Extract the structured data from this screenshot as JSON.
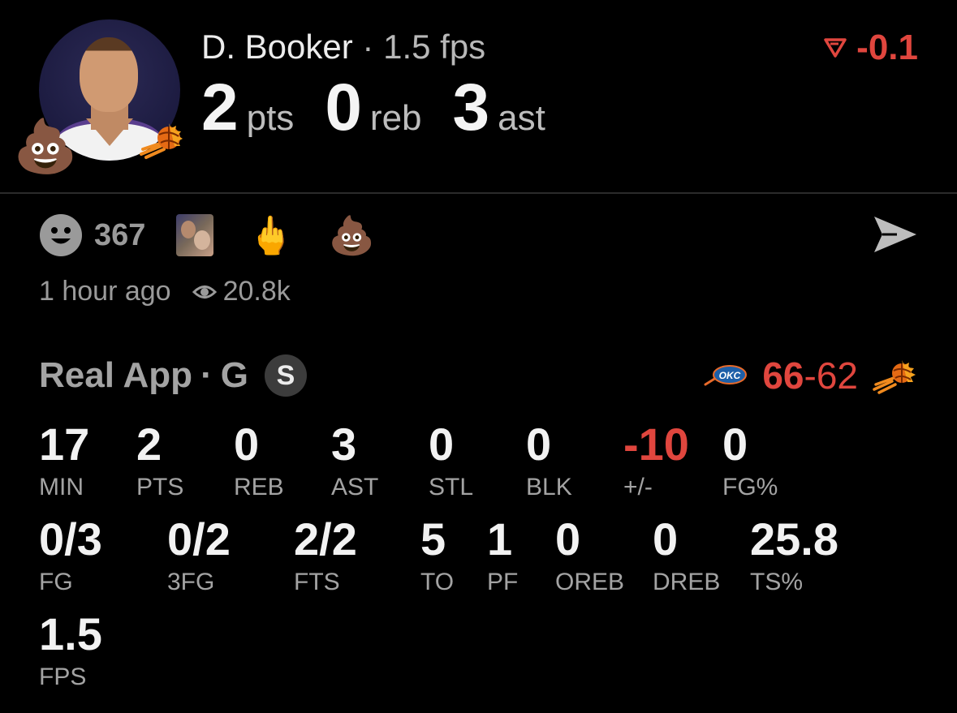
{
  "player": {
    "name": "D. Booker",
    "separator": "·",
    "fps": "1.5 fps",
    "delta": "-0.1",
    "delta_color": "#e0463e",
    "headline": [
      {
        "value": "2",
        "unit": "pts"
      },
      {
        "value": "0",
        "unit": "reb"
      },
      {
        "value": "3",
        "unit": "ast"
      }
    ]
  },
  "icons": {
    "badge_emoji": "💩",
    "team_badge": "suns-logo-icon",
    "delta_icon": "down-triangle-icon"
  },
  "reactions": {
    "count": "367",
    "items": [
      {
        "name": "photo-reaction"
      },
      {
        "name": "middle-finger",
        "emoji": "🖕"
      },
      {
        "name": "poop",
        "emoji": "💩"
      }
    ]
  },
  "meta": {
    "time": "1 hour ago",
    "views": "20.8k"
  },
  "game": {
    "source": "Real App",
    "dot": "·",
    "position": "G",
    "badge": "S",
    "score_home": "66",
    "score_dash": "-",
    "score_away": "62",
    "home_team": "OKC",
    "accent_red": "#e0463e"
  },
  "stats": {
    "row1": [
      {
        "value": "17",
        "label": "MIN"
      },
      {
        "value": "2",
        "label": "PTS"
      },
      {
        "value": "0",
        "label": "REB"
      },
      {
        "value": "3",
        "label": "AST"
      },
      {
        "value": "0",
        "label": "STL"
      },
      {
        "value": "0",
        "label": "BLK"
      },
      {
        "value": "-10",
        "label": "+/-"
      },
      {
        "value": "0",
        "label": "FG%"
      }
    ],
    "row2": [
      {
        "value": "0/3",
        "label": "FG"
      },
      {
        "value": "0/2",
        "label": "3FG"
      },
      {
        "value": "2/2",
        "label": "FTS"
      },
      {
        "value": "5",
        "label": "TO"
      },
      {
        "value": "1",
        "label": "PF"
      },
      {
        "value": "0",
        "label": "OREB"
      },
      {
        "value": "0",
        "label": "DREB"
      },
      {
        "value": "25.8",
        "label": "TS%"
      }
    ],
    "row3": [
      {
        "value": "1.5",
        "label": "FPS"
      }
    ]
  }
}
